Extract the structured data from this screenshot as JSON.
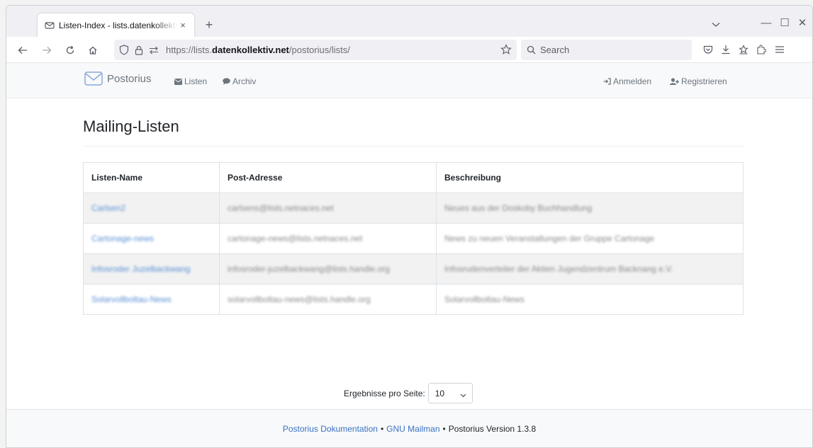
{
  "browser": {
    "tab_title": "Listen-Index - lists.datenkollektiv.net",
    "close_glyph": "×",
    "newtab_glyph": "+",
    "url_prefix": "https://lists.",
    "url_domain": "datenkollektiv.net",
    "url_path": "/postorius/lists/",
    "search_placeholder": "Search",
    "min_glyph": "—",
    "max_glyph": "☐",
    "close_window_glyph": "✕"
  },
  "nav": {
    "brand": "Postorius",
    "lists": "Listen",
    "archive": "Archiv",
    "login": "Anmelden",
    "register": "Registrieren"
  },
  "main": {
    "title": "Mailing-Listen",
    "columns": [
      "Listen-Name",
      "Post-Adresse",
      "Beschreibung"
    ],
    "rows": [
      {
        "name": "Carlsen2",
        "address": "carlsens@lists.netnaces.net",
        "description": "Neues aus der Doskoby Buchhandlung"
      },
      {
        "name": "Cartonage-news",
        "address": "cartonage-news@lists.netnaces.net",
        "description": "News zu neuen Veranstaltungen der Gruppe Cartonage"
      },
      {
        "name": "Infosroder Juzelbackwang",
        "address": "infosroder-juzelbackwang@lists.handle.org",
        "description": "Infosrudenverteiler der Aktien Jugendzentrum Backnang e.V."
      },
      {
        "name": "Solarvollboltau-News",
        "address": "solarvollboltau-news@lists.handle.org",
        "description": "Solarvollboltau-News"
      }
    ],
    "per_page_label": "Ergebnisse pro Seite:",
    "per_page_value": "10"
  },
  "footer": {
    "doc_link": "Postorius Dokumentation",
    "mailman_link": "GNU Mailman",
    "version": "Postorius Version 1.3.8",
    "separator": "•"
  }
}
